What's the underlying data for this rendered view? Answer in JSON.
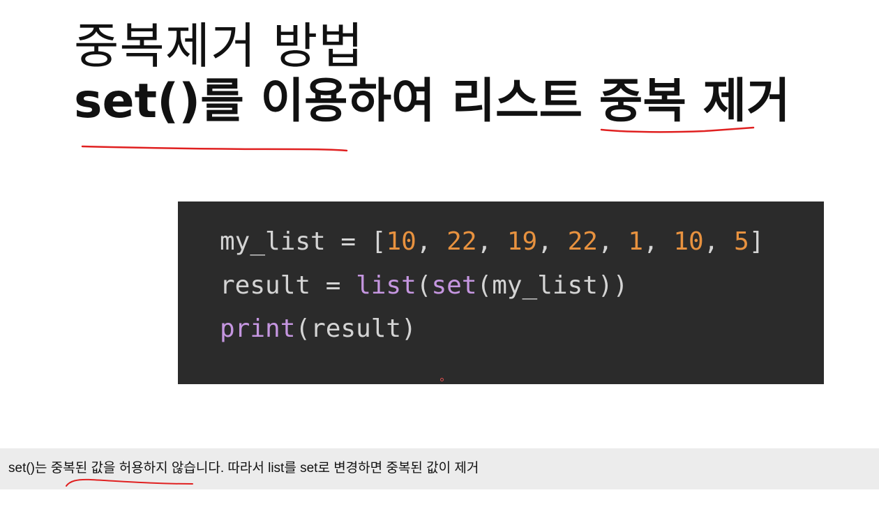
{
  "slide": {
    "title_line1": "중복제거 방법",
    "title_line2": "set()를 이용하여 리스트 중복 제거"
  },
  "code": {
    "line1": {
      "var": "my_list",
      "eq": " = ",
      "open": "[",
      "n1": "10",
      "c1": ", ",
      "n2": "22",
      "c2": ", ",
      "n3": "19",
      "c3": ", ",
      "n4": "22",
      "c4": ", ",
      "n5": "1",
      "c5": ", ",
      "n6": "10",
      "c6": ", ",
      "n7": "5",
      "close": "]"
    },
    "line2": {
      "var": "result",
      "eq": " = ",
      "fn1": "list",
      "p1": "(",
      "fn2": "set",
      "p2": "(",
      "arg": "my_list",
      "p3": "))"
    },
    "line3": {
      "fn": "print",
      "p1": "(",
      "arg": "result",
      "p2": ")"
    }
  },
  "caption": {
    "text": "set()는 중복된 값을 허용하지 않습니다. 따라서 list를 set로 변경하면 중복된 값이 제거"
  },
  "colors": {
    "code_background": "#2b2b2b",
    "number": "#e8923f",
    "builtin_function": "#c596e0",
    "annotation_ink": "#e02020",
    "caption_background": "#ececec"
  }
}
